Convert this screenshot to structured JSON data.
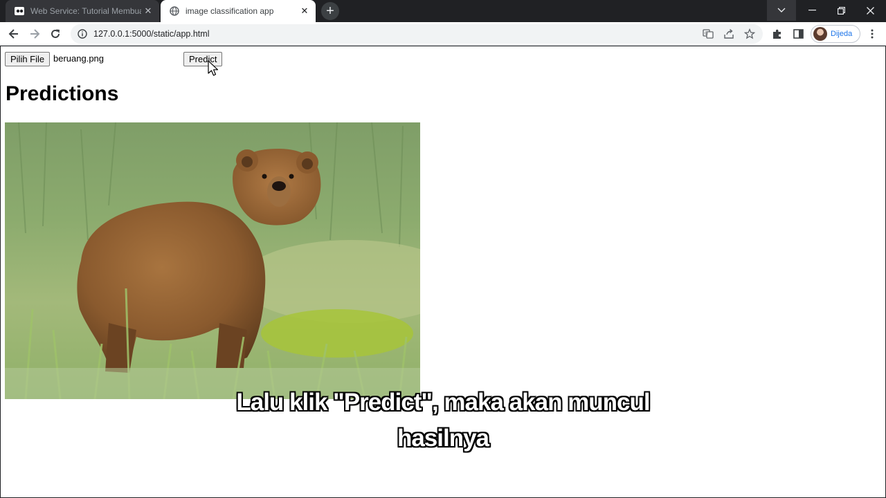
{
  "browser": {
    "tabs": [
      {
        "title": "Web Service: Tutorial Membuat",
        "active": false,
        "favicon": "video-icon"
      },
      {
        "title": "image classification app",
        "active": true,
        "favicon": "globe-icon"
      }
    ],
    "url": "127.0.0.1:5000/static/app.html",
    "profile_name": "Dijeda"
  },
  "page": {
    "file_button_label": "Pilih File",
    "file_name": "beruang.png",
    "predict_button_label": "Predict",
    "heading": "Predictions",
    "image_subject": "brown bear standing in green grass"
  },
  "subtitle": {
    "line1": "Lalu klik \"Predict\", maka akan muncul",
    "line2": "hasilnya"
  },
  "colors": {
    "titlebar": "#202124",
    "accent": "#1a73e8"
  }
}
